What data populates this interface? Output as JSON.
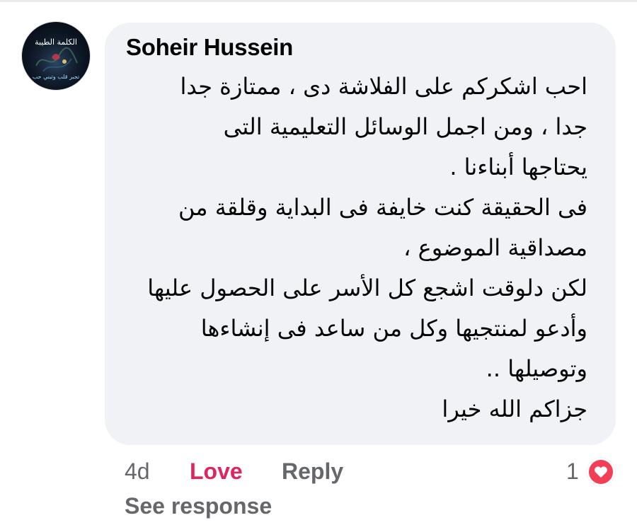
{
  "comment": {
    "author": "Soheir Hussein",
    "avatar": {
      "icon": "profile-avatar",
      "logo_text_top": "الكلمة الطيبة",
      "logo_text_bottom": "تجبر قلب وتبني حب"
    },
    "lines": [
      "احب اشكركم على الفلاشة دى ، ممتازة جدا",
      "جدا ، ومن اجمل الوسائل التعليمية التى",
      "يحتاجها أبناءنا .",
      "فى الحقيقة كنت خايفة فى البداية وقلقة من",
      "مصداقية الموضوع ،",
      "لكن دلوقت اشجع كل الأسر على الحصول عليها",
      "وأدعو لمنتجيها وكل من ساعد فى إنشاءها",
      "وتوصيلها ..",
      "جزاكم الله خيرا"
    ]
  },
  "actions": {
    "timestamp": "4d",
    "love_label": "Love",
    "reply_label": "Reply",
    "reaction_count": "1",
    "reaction_icon": "love-reaction-icon",
    "see_response_label": "See response"
  },
  "colors": {
    "bubble_bg": "#f0f2f5",
    "love": "#e0245e",
    "secondary_text": "#65676b",
    "reaction_heart": "#f33e58"
  }
}
